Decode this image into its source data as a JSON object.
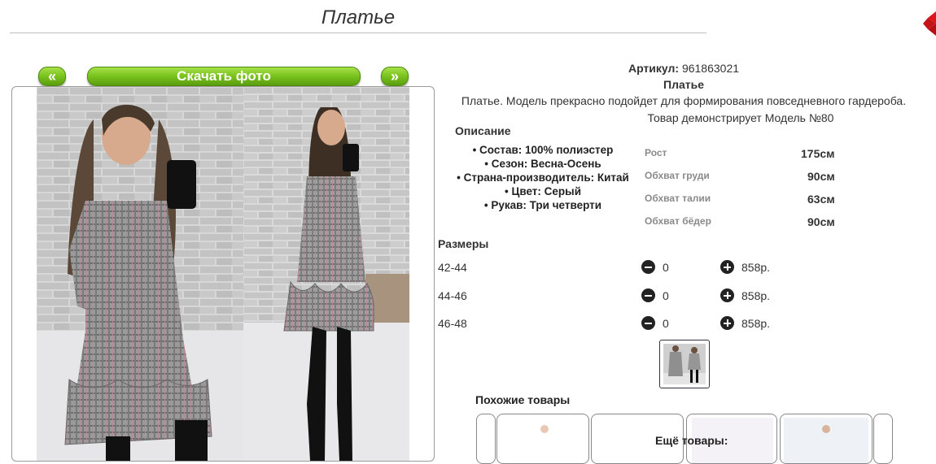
{
  "header": {
    "title": "Платье"
  },
  "gallery": {
    "prev_label": "«",
    "download_label": "Скачать фото",
    "next_label": "»"
  },
  "product": {
    "sku_label": "Артикул:",
    "sku_value": "961863021",
    "name": "Платье",
    "description": "Платье. Модель прекрасно подойдет для формирования повседневного гардероба.",
    "model_note": "Товар демонстрирует Модель №80"
  },
  "details": {
    "title": "Описание",
    "items": [
      "Состав: 100% полиэстер",
      "Сезон: Весна-Осень",
      "Страна-производитель: Китай",
      "Цвет: Серый",
      "Рукав: Три четверти"
    ]
  },
  "model_params": [
    {
      "label": "Рост",
      "value": "175см"
    },
    {
      "label": "Обхват груди",
      "value": "90см"
    },
    {
      "label": "Обхват талии",
      "value": "63см"
    },
    {
      "label": "Обхват бёдер",
      "value": "90см"
    }
  ],
  "sizes": {
    "title": "Размеры",
    "rows": [
      {
        "size": "42-44",
        "qty": "0",
        "price": "858р."
      },
      {
        "size": "44-46",
        "qty": "0",
        "price": "858р."
      },
      {
        "size": "46-48",
        "qty": "0",
        "price": "858р."
      }
    ]
  },
  "similar": {
    "title": "Похожие товары"
  },
  "more": {
    "title": "Ещё товары:"
  },
  "colors": {
    "accent_green": "#79c21c",
    "brand_red": "#e0151b"
  }
}
